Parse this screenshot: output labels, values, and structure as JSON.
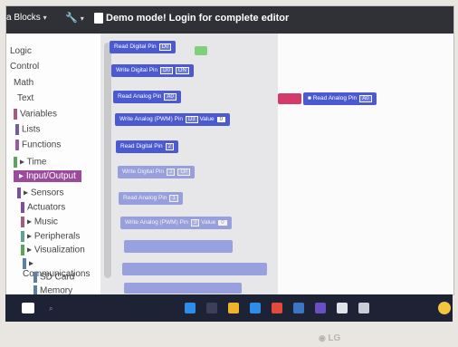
{
  "topbar": {
    "blocks_label": "a Blocks",
    "demo_message": "Demo mode! Login for complete editor"
  },
  "sidebar": {
    "categories": [
      {
        "label": "Logic",
        "color": "#5b80a5"
      },
      {
        "label": "Control",
        "color": "#5ba55b"
      },
      {
        "label": "Math",
        "color": "#5b67a5"
      },
      {
        "label": "Text",
        "color": "#5ba58c"
      },
      {
        "label": "Variables",
        "color": "#a55b80"
      },
      {
        "label": "Lists",
        "color": "#745ba5"
      },
      {
        "label": "Functions",
        "color": "#995ba5"
      },
      {
        "label": "Time",
        "color": "#5ba55b"
      },
      {
        "label": "Input/Output",
        "color": "#9b4a9c"
      },
      {
        "label": "Sensors",
        "color": "#7a4fa3"
      },
      {
        "label": "Actuators",
        "color": "#7a4fa3"
      },
      {
        "label": "Music",
        "color": "#a55b80"
      },
      {
        "label": "Peripherals",
        "color": "#5ba58c"
      },
      {
        "label": "Visualization",
        "color": "#5ba55b"
      },
      {
        "label": "Communications",
        "color": "#5b80a5"
      },
      {
        "label": "SD Card",
        "color": "#5b80a5"
      },
      {
        "label": "Memory",
        "color": "#5b80a5"
      }
    ]
  },
  "flyout": {
    "blocks": [
      {
        "label": "Read Digital Pin",
        "chip": "D0"
      },
      {
        "label": "Write Digital Pin",
        "chip": "D0",
        "chip2": "ON"
      },
      {
        "label": "Read Analog Pin",
        "chip": "A0"
      },
      {
        "label": "Write Analog (PWM) Pin",
        "chip": "D3",
        "extra": "Value",
        "chip2": "0"
      },
      {
        "label": "Read Digital Pin",
        "chip": "2"
      },
      {
        "label": "Write Digital Pin",
        "chip": "2",
        "chip2": "On"
      },
      {
        "label": "Read Analog Pin",
        "chip": "1"
      },
      {
        "label": "Write Analog (PWM) Pin",
        "chip": "3",
        "extra": "Value",
        "chip2": "0"
      }
    ]
  },
  "workspace": {
    "connected_block": "Read Analog Pin",
    "connected_chip": "A0"
  },
  "monitor_brand": "LG"
}
